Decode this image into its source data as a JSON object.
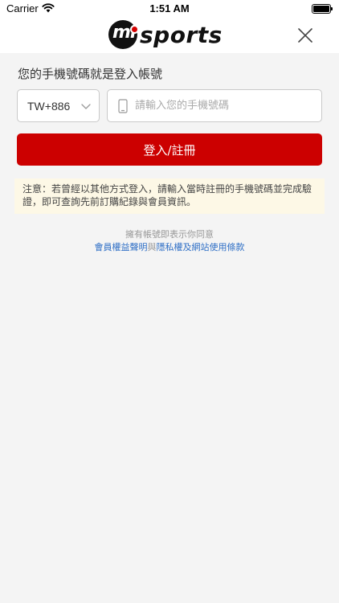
{
  "status_bar": {
    "carrier": "Carrier",
    "time": "1:51 AM"
  },
  "header": {
    "logo": {
      "mark": "mi",
      "text": "sports"
    },
    "icons": {
      "close": "close-icon"
    }
  },
  "login": {
    "heading": "您的手機號碼就是登入帳號",
    "country_code": "TW+886",
    "phone_placeholder": "請輸入您的手機號碼",
    "phone_value": "",
    "submit_label": "登入/註冊"
  },
  "notice": {
    "text": "注意：若曾經以其他方式登入，請輸入當時註冊的手機號碼並完成驗證，即可查詢先前訂購紀錄與會員資訊。"
  },
  "terms": {
    "prefix": "擁有帳號即表示你同意",
    "link_member": "會員權益聲明",
    "conjunction": "與",
    "link_privacy": "隱私權及網站使用條款"
  },
  "colors": {
    "accent": "#cc0000",
    "link": "#2f6fc6",
    "notice_bg": "#fdf8e6"
  }
}
